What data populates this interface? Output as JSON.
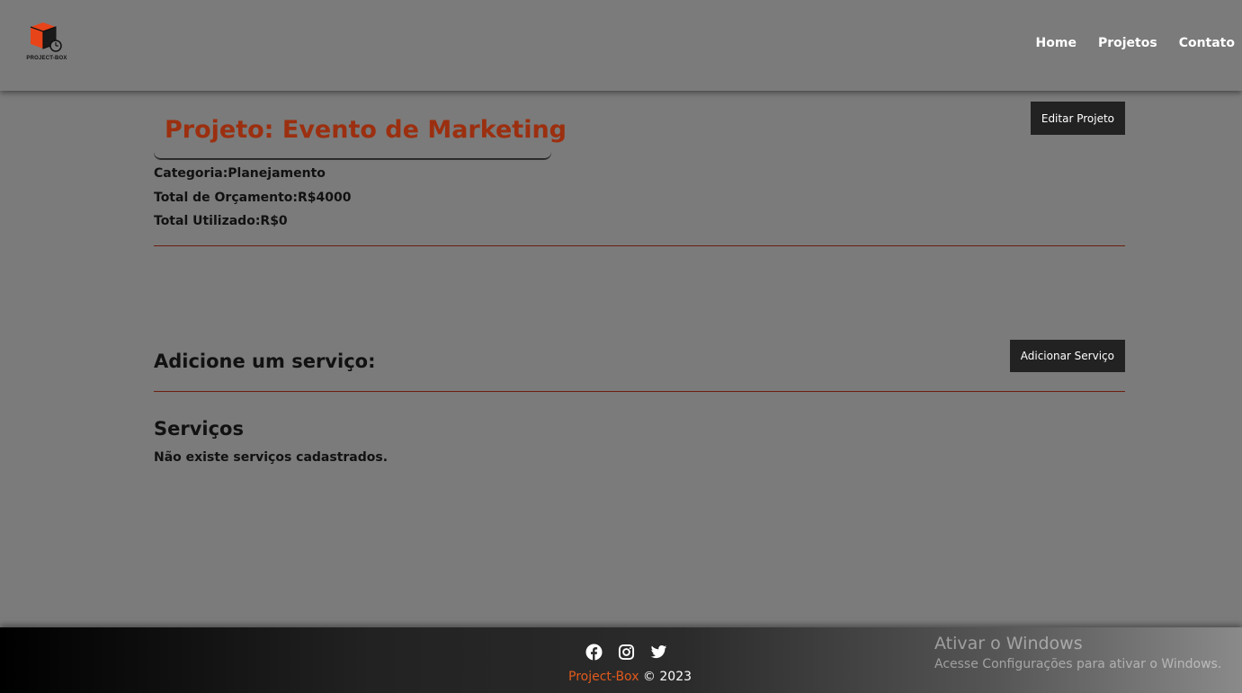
{
  "header": {
    "logo_text": "PROJECT-BOX",
    "nav": [
      {
        "label": "Home"
      },
      {
        "label": "Projetos"
      },
      {
        "label": "Contato"
      }
    ]
  },
  "project": {
    "title": "Projeto: Evento de Marketing",
    "edit_button": "Editar Projeto",
    "category": "Categoria:Planejamento",
    "budget": "Total de Orçamento:R$4000",
    "used": "Total Utilizado:R$0"
  },
  "service_form": {
    "title": "Adicione um serviço:",
    "add_button": "Adicionar Serviço"
  },
  "services": {
    "title": "Serviços",
    "empty_message": "Não existe serviços cadastrados."
  },
  "footer": {
    "social_icons": [
      "facebook-icon",
      "instagram-icon",
      "twitter-icon"
    ],
    "brand": "Project-Box",
    "copyright": " © 2023"
  },
  "windows_watermark": {
    "title": "Ativar o Windows",
    "subtitle": "Acesse Configurações para ativar o Windows."
  },
  "colors": {
    "background": "#7b7b7b",
    "title": "#9b2f0f",
    "brand": "#e25a1c",
    "divider": "#6b1e10",
    "button": "#222222"
  }
}
